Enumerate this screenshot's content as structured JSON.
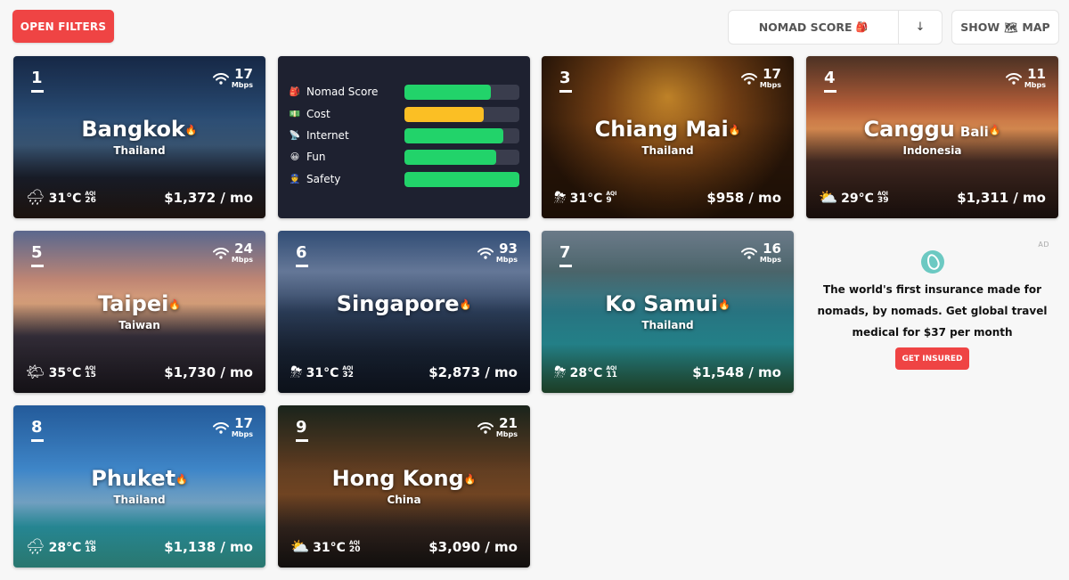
{
  "toolbar": {
    "open_filters": "OPEN FILTERS",
    "sort_label": "NOMAD SCORE",
    "sort_icon": "backpack-icon",
    "sort_direction": "↓",
    "show_label": "SHOW",
    "map_label": "MAP",
    "map_icon": "world-map-icon"
  },
  "stats": [
    {
      "icon": "🎒",
      "label": "Nomad Score",
      "value": 0.75,
      "color": "#22d36a"
    },
    {
      "icon": "💵",
      "label": "Cost",
      "value": 0.69,
      "color": "#fbbf24"
    },
    {
      "icon": "📡",
      "label": "Internet",
      "value": 0.86,
      "color": "#22d36a"
    },
    {
      "icon": "😀",
      "label": "Fun",
      "value": 0.8,
      "color": "#22d36a"
    },
    {
      "icon": "👮",
      "label": "Safety",
      "value": 1.0,
      "color": "#22d36a"
    }
  ],
  "cities": [
    {
      "rank": "1",
      "name": "Bangkok",
      "name_suffix": "",
      "country": "Thailand",
      "speed": "17",
      "unit": "Mbps",
      "weather_icon": "🌧",
      "temp": "31°C",
      "aqi_label": "AQI",
      "aqi": "26",
      "price": "$1,372 / mo"
    },
    {
      "rank": "3",
      "name": "Chiang Mai",
      "name_suffix": "",
      "country": "Thailand",
      "speed": "17",
      "unit": "Mbps",
      "weather_icon": "⛈",
      "temp": "31°C",
      "aqi_label": "AQI",
      "aqi": "9",
      "price": "$958 / mo"
    },
    {
      "rank": "4",
      "name": "Canggu",
      "name_suffix": "Bali",
      "country": "Indonesia",
      "speed": "11",
      "unit": "Mbps",
      "weather_icon": "⛅",
      "temp": "29°C",
      "aqi_label": "AQI",
      "aqi": "39",
      "price": "$1,311 / mo"
    },
    {
      "rank": "5",
      "name": "Taipei",
      "name_suffix": "",
      "country": "Taiwan",
      "speed": "24",
      "unit": "Mbps",
      "weather_icon": "🌤",
      "temp": "35°C",
      "aqi_label": "AQI",
      "aqi": "15",
      "price": "$1,730 / mo"
    },
    {
      "rank": "6",
      "name": "Singapore",
      "name_suffix": "",
      "country": "",
      "speed": "93",
      "unit": "Mbps",
      "weather_icon": "⛈",
      "temp": "31°C",
      "aqi_label": "AQI",
      "aqi": "32",
      "price": "$2,873 / mo"
    },
    {
      "rank": "7",
      "name": "Ko Samui",
      "name_suffix": "",
      "country": "Thailand",
      "speed": "16",
      "unit": "Mbps",
      "weather_icon": "⛈",
      "temp": "28°C",
      "aqi_label": "AQI",
      "aqi": "11",
      "price": "$1,548 / mo"
    },
    {
      "rank": "8",
      "name": "Phuket",
      "name_suffix": "",
      "country": "Thailand",
      "speed": "17",
      "unit": "Mbps",
      "weather_icon": "🌧",
      "temp": "28°C",
      "aqi_label": "AQI",
      "aqi": "18",
      "price": "$1,138 / mo"
    },
    {
      "rank": "9",
      "name": "Hong Kong",
      "name_suffix": "",
      "country": "China",
      "speed": "21",
      "unit": "Mbps",
      "weather_icon": "⛅",
      "temp": "31°C",
      "aqi_label": "AQI",
      "aqi": "20",
      "price": "$3,090 / mo"
    }
  ],
  "ad": {
    "tag": "AD",
    "text": "The world's first insurance made for nomads, by nomads. Get global travel medical for $37 per month",
    "button": "GET INSURED"
  }
}
